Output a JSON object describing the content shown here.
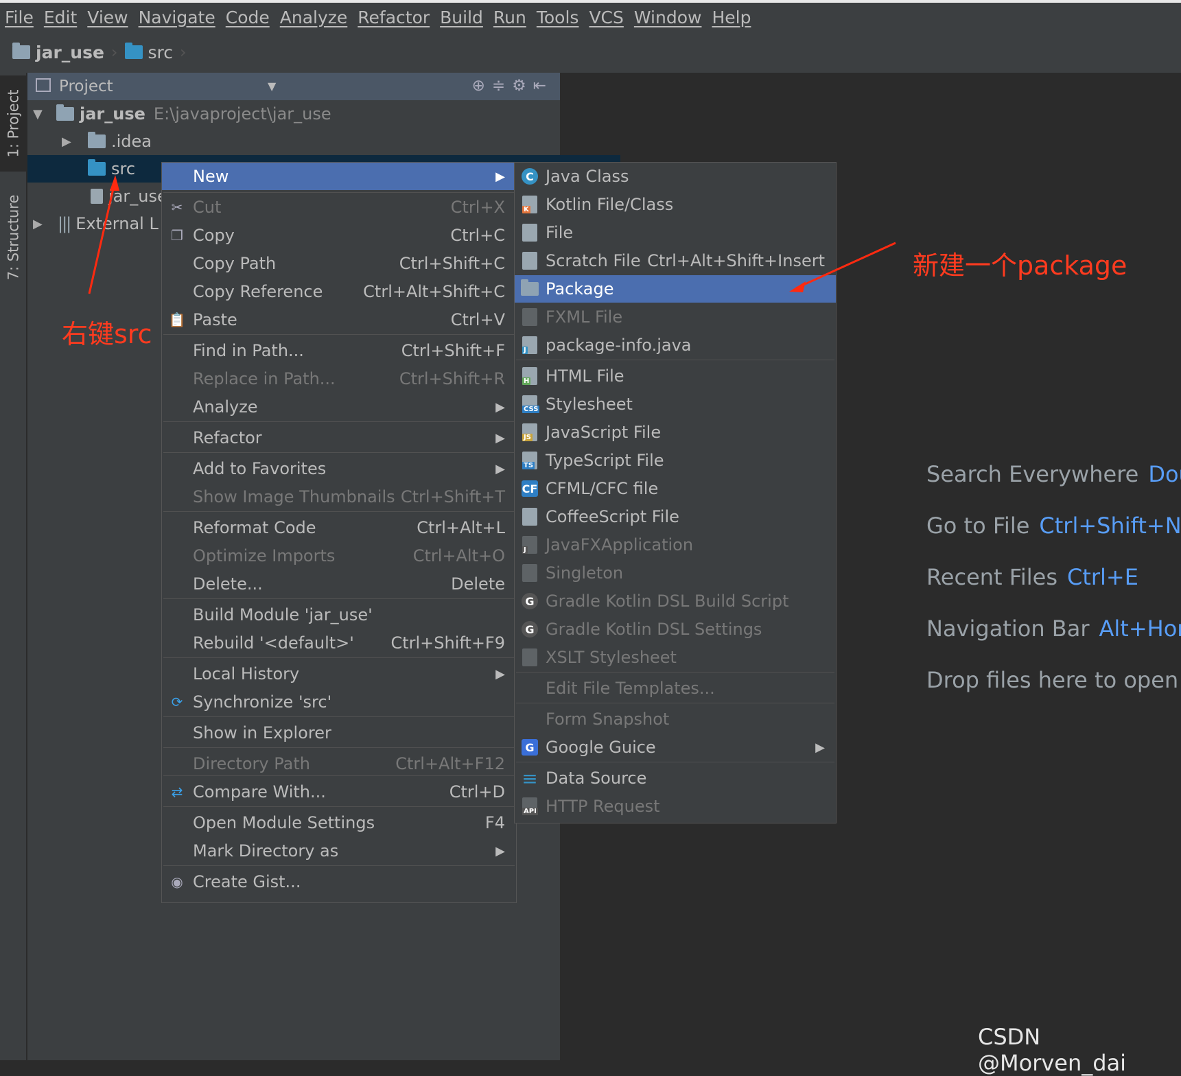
{
  "menubar": [
    "File",
    "Edit",
    "View",
    "Navigate",
    "Code",
    "Analyze",
    "Refactor",
    "Build",
    "Run",
    "Tools",
    "VCS",
    "Window",
    "Help"
  ],
  "breadcrumb": {
    "project": "jar_use",
    "folder": "src"
  },
  "sidebar": {
    "project_tab": "1: Project",
    "structure_tab": "7: Structure"
  },
  "project_panel": {
    "title": "Project",
    "root_name": "jar_use",
    "root_path": "E:\\javaproject\\jar_use",
    "idea": ".idea",
    "src": "src",
    "iml": "jar_use",
    "external": "External L"
  },
  "context_menu": [
    {
      "label": "New",
      "shortcut": "",
      "submenu": true,
      "state": "highlight"
    },
    {
      "label": "Cut",
      "shortcut": "Ctrl+X",
      "state": "disabled",
      "icon": "scissors-icon"
    },
    {
      "label": "Copy",
      "shortcut": "Ctrl+C",
      "icon": "copy-icon"
    },
    {
      "label": "Copy Path",
      "shortcut": "Ctrl+Shift+C"
    },
    {
      "label": "Copy Reference",
      "shortcut": "Ctrl+Alt+Shift+C"
    },
    {
      "label": "Paste",
      "shortcut": "Ctrl+V",
      "icon": "paste-icon"
    },
    {
      "label": "Find in Path...",
      "shortcut": "Ctrl+Shift+F"
    },
    {
      "label": "Replace in Path...",
      "shortcut": "Ctrl+Shift+R",
      "state": "disabled"
    },
    {
      "label": "Analyze",
      "shortcut": "",
      "submenu": true
    },
    {
      "label": "Refactor",
      "shortcut": "",
      "submenu": true
    },
    {
      "label": "Add to Favorites",
      "shortcut": "",
      "submenu": true
    },
    {
      "label": "Show Image Thumbnails",
      "shortcut": "Ctrl+Shift+T",
      "state": "disabled"
    },
    {
      "label": "Reformat Code",
      "shortcut": "Ctrl+Alt+L"
    },
    {
      "label": "Optimize Imports",
      "shortcut": "Ctrl+Alt+O",
      "state": "disabled"
    },
    {
      "label": "Delete...",
      "shortcut": "Delete"
    },
    {
      "label": "Build Module 'jar_use'",
      "shortcut": ""
    },
    {
      "label": "Rebuild '<default>'",
      "shortcut": "Ctrl+Shift+F9"
    },
    {
      "label": "Local History",
      "shortcut": "",
      "submenu": true
    },
    {
      "label": "Synchronize 'src'",
      "shortcut": "",
      "icon": "sync-icon"
    },
    {
      "label": "Show in Explorer",
      "shortcut": ""
    },
    {
      "label": "Directory Path",
      "shortcut": "Ctrl+Alt+F12",
      "state": "disabled"
    },
    {
      "label": "Compare With...",
      "shortcut": "Ctrl+D",
      "icon": "compare-icon"
    },
    {
      "label": "Open Module Settings",
      "shortcut": "F4"
    },
    {
      "label": "Mark Directory as",
      "shortcut": "",
      "submenu": true
    },
    {
      "label": "Create Gist...",
      "shortcut": "",
      "icon": "github-icon"
    }
  ],
  "new_submenu": [
    {
      "label": "Java Class",
      "shortcut": "",
      "icon": "java-class-icon"
    },
    {
      "label": "Kotlin File/Class",
      "shortcut": "",
      "icon": "kotlin-file-icon"
    },
    {
      "label": "File",
      "shortcut": "",
      "icon": "file-icon"
    },
    {
      "label": "Scratch File",
      "shortcut": "Ctrl+Alt+Shift+Insert",
      "icon": "scratch-file-icon"
    },
    {
      "label": "Package",
      "shortcut": "",
      "state": "highlight",
      "icon": "package-icon"
    },
    {
      "label": "FXML File",
      "shortcut": "",
      "state": "disabled",
      "icon": "fxml-file-icon"
    },
    {
      "label": "package-info.java",
      "shortcut": "",
      "icon": "java-file-icon"
    },
    {
      "label": "HTML File",
      "shortcut": "",
      "icon": "html-file-icon"
    },
    {
      "label": "Stylesheet",
      "shortcut": "",
      "icon": "css-file-icon"
    },
    {
      "label": "JavaScript File",
      "shortcut": "",
      "icon": "js-file-icon"
    },
    {
      "label": "TypeScript File",
      "shortcut": "",
      "icon": "ts-file-icon"
    },
    {
      "label": "CFML/CFC file",
      "shortcut": "",
      "icon": "cfml-file-icon"
    },
    {
      "label": "CoffeeScript File",
      "shortcut": "",
      "icon": "coffee-file-icon"
    },
    {
      "label": "JavaFXApplication",
      "shortcut": "",
      "state": "disabled",
      "icon": "javafx-file-icon"
    },
    {
      "label": "Singleton",
      "shortcut": "",
      "state": "disabled",
      "icon": "singleton-file-icon"
    },
    {
      "label": "Gradle Kotlin DSL Build Script",
      "shortcut": "",
      "state": "disabled",
      "icon": "gradle-icon"
    },
    {
      "label": "Gradle Kotlin DSL Settings",
      "shortcut": "",
      "state": "disabled",
      "icon": "gradle-settings-icon"
    },
    {
      "label": "XSLT Stylesheet",
      "shortcut": "",
      "state": "disabled",
      "icon": "xslt-file-icon"
    },
    {
      "label": "Edit File Templates...",
      "shortcut": "",
      "state": "disabled"
    },
    {
      "label": "Form Snapshot",
      "shortcut": "",
      "state": "disabled"
    },
    {
      "label": "Google Guice",
      "shortcut": "",
      "submenu": true,
      "icon": "guice-icon"
    },
    {
      "label": "Data Source",
      "shortcut": "",
      "icon": "database-icon"
    },
    {
      "label": "HTTP Request",
      "shortcut": "",
      "state": "disabled",
      "icon": "http-request-icon"
    }
  ],
  "editor_hints": [
    {
      "label": "Search Everywhere",
      "key": "Doul"
    },
    {
      "label": "Go to File",
      "key": "Ctrl+Shift+N"
    },
    {
      "label": "Recent Files",
      "key": "Ctrl+E"
    },
    {
      "label": "Navigation Bar",
      "key": "Alt+Hon"
    },
    {
      "label": "Drop files here to open",
      "key": ""
    }
  ],
  "annotations": {
    "right_click": "右键src",
    "new_package": "新建一个package"
  },
  "watermark": "CSDN @Morven_dai",
  "colors": {
    "highlight": "#4b6eaf",
    "annotation": "#ff3b1f",
    "hint_key": "#589df6"
  }
}
